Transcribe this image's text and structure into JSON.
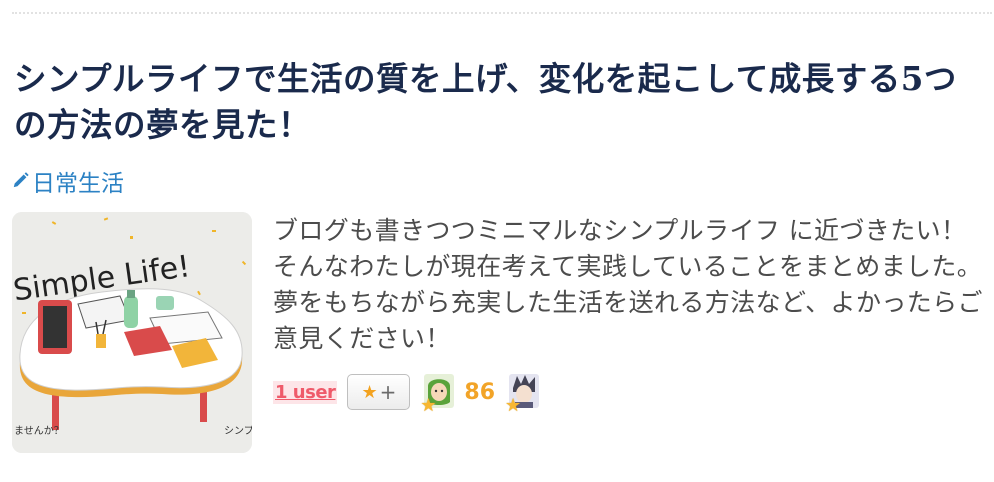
{
  "article": {
    "title": "シンプルライフで生活の質を上げ、変化を起こして成長する5つの方法の夢を見た！",
    "category": "日常生活",
    "excerpt": "ブログも書きつつミニマルなシンプルライフ に近づきたい！そんなわたしが現在考えて実践していることをまとめました。夢をもちながら充実した生活を送れる方法など、よかったらご意見ください！"
  },
  "thumbnail": {
    "headline": "Simple Life!",
    "caption_left": "ませんか？",
    "caption_right": "シンプ"
  },
  "bookmark": {
    "users_label": "1 user",
    "add_star_label": "+",
    "star_count": "86",
    "star_icon": "star-icon"
  },
  "colors": {
    "title": "#1a2a4c",
    "category_link": "#2c82c4",
    "excerpt": "#4c4c4c",
    "users_badge": "#ef5a6a",
    "star": "#f2a428"
  }
}
